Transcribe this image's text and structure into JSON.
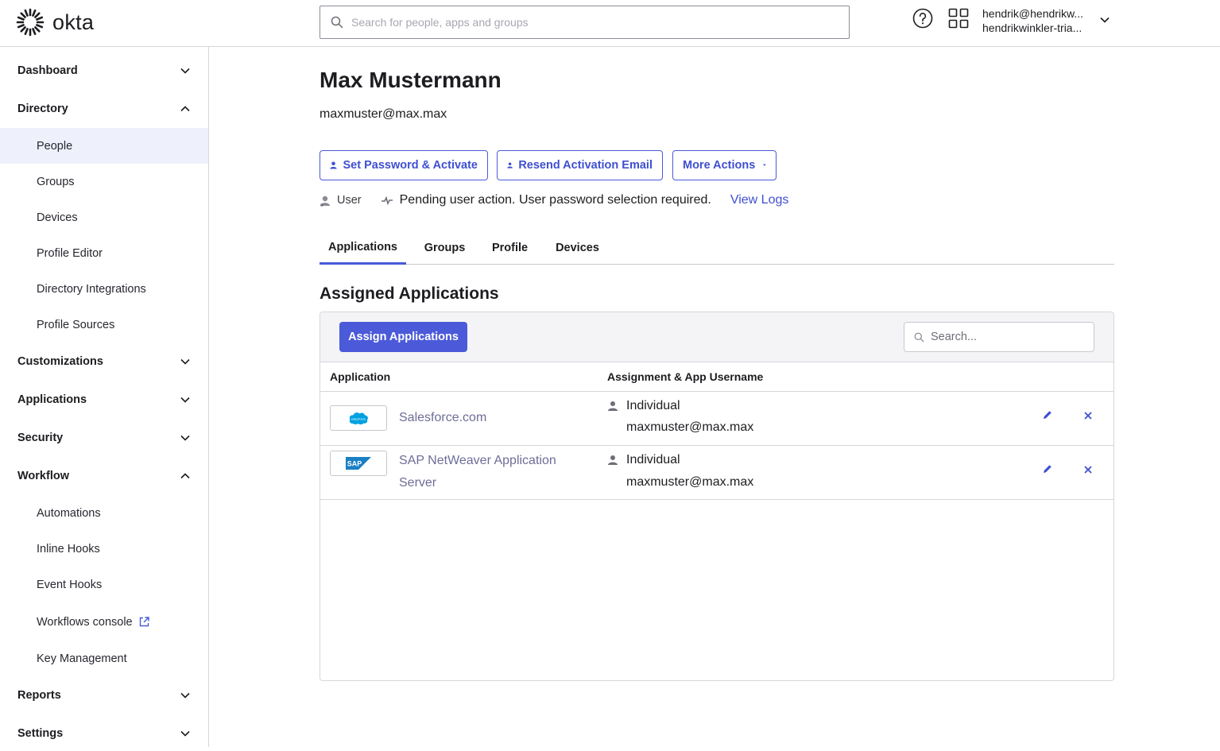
{
  "header": {
    "logo_text": "okta",
    "search_placeholder": "Search for people, apps and groups",
    "user_email": "hendrik@hendrikw...",
    "user_org": "hendrikwinkler-tria..."
  },
  "sidebar": {
    "sections": {
      "dashboard": "Dashboard",
      "directory": "Directory",
      "customizations": "Customizations",
      "applications": "Applications",
      "security": "Security",
      "workflow": "Workflow",
      "reports": "Reports",
      "settings": "Settings"
    },
    "directory_items": [
      "People",
      "Groups",
      "Devices",
      "Profile Editor",
      "Directory Integrations",
      "Profile Sources"
    ],
    "workflow_items": [
      "Automations",
      "Inline Hooks",
      "Event Hooks",
      "Workflows console",
      "Key Management"
    ]
  },
  "user": {
    "name": "Max Mustermann",
    "email": "maxmuster@max.max",
    "role": "User",
    "status": "Pending user action. User password selection required.",
    "view_logs": "View Logs"
  },
  "actions": {
    "set_password": "Set Password & Activate",
    "resend_email": "Resend Activation Email",
    "more_actions": "More Actions"
  },
  "tabs": [
    "Applications",
    "Groups",
    "Profile",
    "Devices"
  ],
  "assigned": {
    "title": "Assigned Applications",
    "assign_button": "Assign Applications",
    "search_placeholder": "Search...",
    "columns": [
      "Application",
      "Assignment & App Username"
    ],
    "rows": [
      {
        "app_name": "Salesforce.com",
        "logo_text": "salesforce",
        "assignment": "Individual",
        "username": "maxmuster@max.max"
      },
      {
        "app_name": "SAP NetWeaver Application Server",
        "logo_text": "SAP",
        "assignment": "Individual",
        "username": "maxmuster@max.max"
      }
    ]
  },
  "colors": {
    "accent": "#4b5ad9",
    "link": "#3f4fd0",
    "app_link": "#6d6d98",
    "active_nav_bg": "#eef0fb",
    "salesforce_blue": "#00a1e0",
    "sap_blue": "#1a7fc4"
  }
}
